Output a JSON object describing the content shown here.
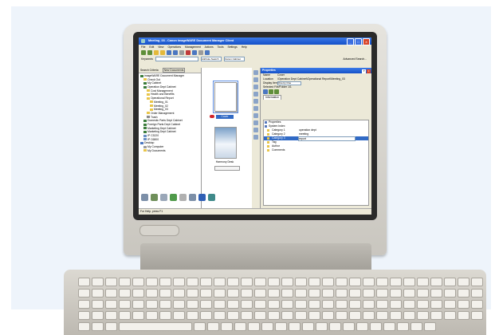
{
  "window": {
    "title": "Meeting_03 - Canon imageWARE Document Manager Client"
  },
  "menubar": [
    "File",
    "Edit",
    "View",
    "Operations",
    "Management",
    "Actions",
    "Tools",
    "Settings",
    "Help"
  ],
  "searchbar": {
    "keywords_label": "Keywords",
    "attribute_search": "Attribute Search",
    "cabinet": "Canon Cabinet",
    "advanced_search": "Advanced Search..."
  },
  "left_panel": {
    "criteria_label": "Search Criteria",
    "new_documents": "New Documents",
    "tree": [
      "imageWARE Document Manager",
      "Check Out",
      "My Cabinet",
      "Operation Dept Cabinet",
      "Cost Management",
      "Health and Benefits",
      "Operational Report",
      "Meeting_01",
      "Meeting_02",
      "Meeting_03",
      "Order Management",
      "Trash",
      "Domestic Parts Dept Cabinet",
      "Foreign Parts Dept Cabinet",
      "Marketing Dept Cabinet",
      "Marketing Dept Cabinet",
      "IP C3220",
      "IP C6800",
      "Desktop",
      "My Computer",
      "My Documents"
    ]
  },
  "documents": [
    {
      "label": "Cover"
    },
    {
      "label": "Harmony Desk"
    }
  ],
  "properties": {
    "title": "Properties",
    "name_label": "Name",
    "name_value": "Cover",
    "location_label": "Location",
    "location_value": "\\Operation Dept Cabinet\\Operational Report\\Meeting_03",
    "display_items_label": "Display Items",
    "display_items_value": "One by One",
    "selected_label": "Selected File/Folder",
    "selected_value": "1/1",
    "tab": "Information",
    "rows": [
      {
        "name": "Properties",
        "value": ""
      },
      {
        "name": "System Index",
        "value": ""
      },
      {
        "name": "Category 1",
        "value": "operation dept"
      },
      {
        "name": "Category 2",
        "value": "meeting"
      },
      {
        "name": "Category 3",
        "value": "report"
      },
      {
        "name": "Tag",
        "value": ""
      },
      {
        "name": "Author",
        "value": ""
      },
      {
        "name": "Comments",
        "value": ""
      }
    ]
  },
  "status": {
    "text": "For Help, press F1"
  },
  "colors": {
    "title_bar": "#1f5fd6",
    "selection": "#316ac5",
    "window_face": "#ece9d8",
    "monitor_shell": "#d8d5ce"
  }
}
